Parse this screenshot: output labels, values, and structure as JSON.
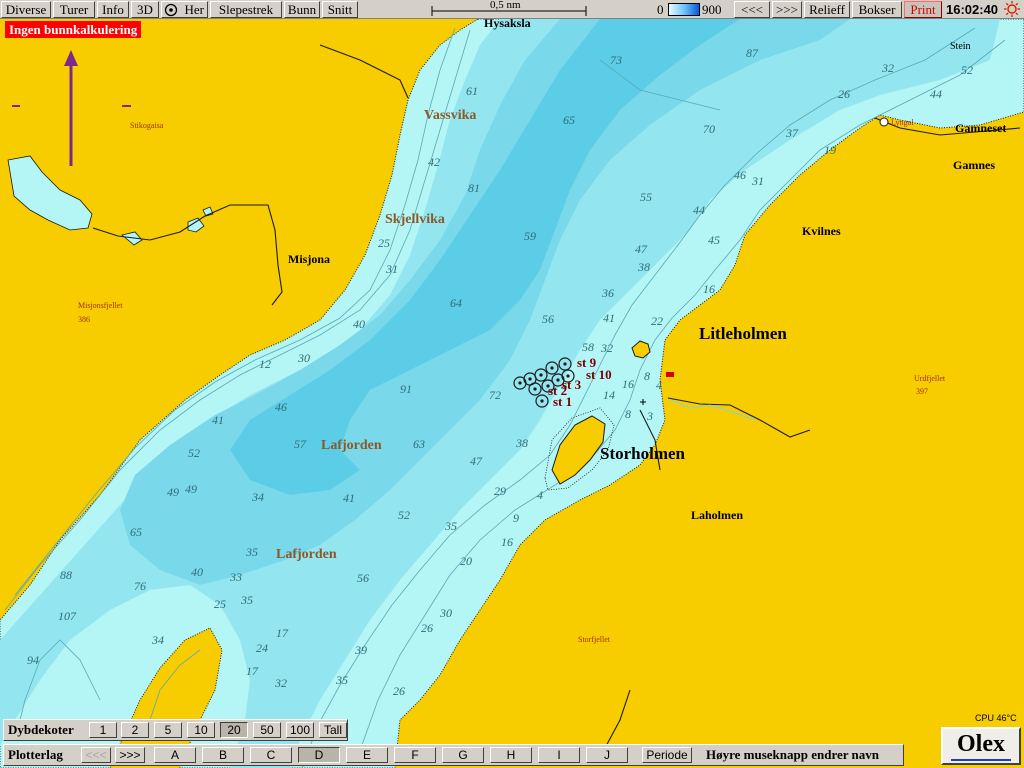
{
  "toolbar": {
    "buttons": [
      {
        "key": "diverse",
        "label": "Diverse"
      },
      {
        "key": "turer",
        "label": "Turer"
      },
      {
        "key": "info",
        "label": "Info"
      },
      {
        "key": "3d",
        "label": "3D"
      },
      {
        "key": "her",
        "label": "Her"
      },
      {
        "key": "slepestrek",
        "label": "Slepestrek"
      },
      {
        "key": "bunn",
        "label": "Bunn"
      },
      {
        "key": "snitt",
        "label": "Snitt"
      }
    ],
    "scale_label": "0,5 nm",
    "depth_scale_min": "0",
    "depth_scale_max": "900",
    "nav_back": "<<<",
    "nav_forward": ">>>",
    "relieff": "Relieff",
    "bokser": "Bokser",
    "print": "Print",
    "clock": "16:02:40"
  },
  "warning": "Ingen bunnkalkulering",
  "places": {
    "hysaksla": "Hysaksla",
    "vassvika": "Vassvika",
    "skjellvika": "Skjellvika",
    "misjona": "Misjona",
    "lafjorden_1": "Lafjorden",
    "lafjorden_2": "Lafjorden",
    "litleholmen": "Litleholmen",
    "storholmen": "Storholmen",
    "laholmen": "Laholmen",
    "kvilnes": "Kvilnes",
    "gamnes": "Gamnes",
    "gamneset": "Gamneset",
    "stein": "Stein",
    "stikogaisa": "Stikogaisa",
    "misjonsfjellet": "Misjonsfjellet",
    "misjonsfjellet_h": "386",
    "urdfjellet": "Urdfjellet",
    "urdfjellet_h": "397",
    "storfjellet": "Storfjellet",
    "lyngol": "Lyngol"
  },
  "stations": {
    "st9": "st 9",
    "st10": "st 10",
    "st3": "st 3",
    "st2": "st 2",
    "st1": "st 1"
  },
  "depths": [
    "87",
    "73",
    "61",
    "65",
    "70",
    "52",
    "26",
    "44",
    "32",
    "37",
    "19",
    "42",
    "81",
    "46",
    "31",
    "55",
    "44",
    "59",
    "47",
    "45",
    "38",
    "25",
    "31",
    "64",
    "36",
    "16",
    "56",
    "41",
    "40",
    "58",
    "32",
    "22",
    "30",
    "12",
    "91",
    "72",
    "16",
    "8",
    "4",
    "14",
    "8",
    "46",
    "41",
    "57",
    "63",
    "47",
    "38",
    "3",
    "52",
    "49",
    "49",
    "34",
    "29",
    "41",
    "52",
    "35",
    "4",
    "9",
    "16",
    "65",
    "35",
    "20",
    "40",
    "33",
    "56",
    "88",
    "76",
    "25",
    "35",
    "107",
    "34",
    "30",
    "26",
    "17",
    "24",
    "39",
    "94",
    "17",
    "32",
    "35",
    "26"
  ],
  "dybdekoter": {
    "label": "Dybdekoter",
    "options": [
      "1",
      "2",
      "5",
      "10",
      "20",
      "50",
      "100",
      "Tall"
    ],
    "selected": "20"
  },
  "plotterlag": {
    "label": "Plotterlag",
    "prev": "<<<",
    "next": ">>>",
    "layers": [
      "A",
      "B",
      "C",
      "D",
      "E",
      "F",
      "G",
      "H",
      "I",
      "J"
    ],
    "selected": "D",
    "periode": "Periode",
    "hint": "Høyre museknapp endrer navn"
  },
  "brand": "Olex",
  "cpu": "CPU 46°C",
  "colors": {
    "land": "#f7cd00",
    "shallow": "#b4f5f6",
    "mid": "#93e6ef",
    "deep": "#79d9eb",
    "deepest": "#5ccde6",
    "contour": "#5aa9b4",
    "stations": "#7a0000",
    "warning": "#ff0000"
  }
}
